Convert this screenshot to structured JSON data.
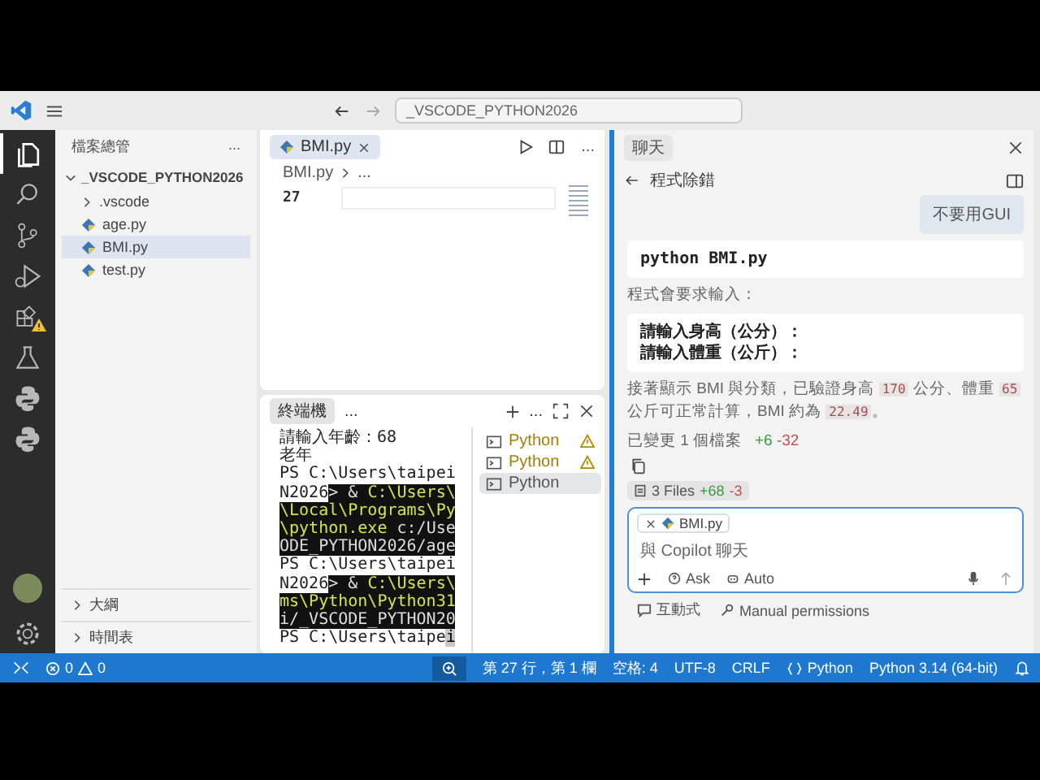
{
  "title_bar": {
    "search": "_VSCODE_PYTHON2026"
  },
  "activity_bar": {
    "items": [
      {
        "kind": "files",
        "selected": true,
        "warning": false
      },
      {
        "kind": "search",
        "selected": false,
        "warning": false
      },
      {
        "kind": "scm",
        "selected": false,
        "warning": false
      },
      {
        "kind": "debug",
        "selected": false,
        "warning": false
      },
      {
        "kind": "extensions",
        "selected": false,
        "warning": true
      },
      {
        "kind": "testing",
        "selected": false,
        "warning": false
      },
      {
        "kind": "python",
        "selected": false,
        "warning": false
      },
      {
        "kind": "python",
        "selected": false,
        "warning": false
      }
    ]
  },
  "sidebar": {
    "title": "檔案總管",
    "more": "...",
    "tree": {
      "label": "_VSCODE_PYTHON2026",
      "expanded": true,
      "children": [
        {
          "label": ".vscode",
          "kind": "folder",
          "expanded": false,
          "selected": false
        },
        {
          "label": "age.py",
          "kind": "file",
          "selected": false
        },
        {
          "label": "BMI.py",
          "kind": "file",
          "selected": true
        },
        {
          "label": "test.py",
          "kind": "file",
          "selected": false
        }
      ]
    },
    "sections": [
      {
        "label": "大綱",
        "expanded": false
      },
      {
        "label": "時間表",
        "expanded": false
      }
    ]
  },
  "editor": {
    "tabs": [
      {
        "label": "BMI.py",
        "selected": true
      }
    ],
    "more": "...",
    "breadcrumb": [
      "BMI.py",
      "..."
    ],
    "line_number": "27"
  },
  "terminal": {
    "tab": "終端機",
    "more": "...",
    "more_right": "...",
    "lines": [
      [
        {
          "text": "請輸入年齡：68",
          "kind": "plain"
        }
      ],
      [
        {
          "text": "老年",
          "kind": "plain"
        }
      ],
      [
        {
          "text": "PS C:\\Users\\taipei",
          "kind": "plain"
        }
      ],
      [
        {
          "text": "N2026",
          "kind": "plain"
        },
        {
          "text": "> & ",
          "kind": "selected"
        },
        {
          "text": "C:\\Users\\",
          "kind": "selected-path"
        }
      ],
      [
        {
          "text": "\\Local\\Programs\\Py",
          "kind": "selected-path"
        }
      ],
      [
        {
          "text": "\\python.exe",
          "kind": "selected-path"
        },
        {
          "text": " c:/Use",
          "kind": "selected"
        }
      ],
      [
        {
          "text": "ODE_PYTHON2026/age",
          "kind": "selected"
        }
      ],
      [
        {
          "text": "PS C:\\Users\\taipei",
          "kind": "plain"
        }
      ],
      [
        {
          "text": "N2026",
          "kind": "plain"
        },
        {
          "text": "> & ",
          "kind": "selected"
        },
        {
          "text": "C:\\Users\\",
          "kind": "selected-path"
        }
      ],
      [
        {
          "text": "ms\\Python\\Python31",
          "kind": "selected-path"
        }
      ],
      [
        {
          "text": "i/_VSCODE_PYTHON20",
          "kind": "selected"
        }
      ],
      [
        {
          "text": "PS C:\\Users\\taipe",
          "kind": "plain"
        },
        {
          "text": "i",
          "kind": "cursor"
        }
      ]
    ],
    "sessions": [
      {
        "label": "Python",
        "warning": true,
        "selected": false
      },
      {
        "label": "Python",
        "warning": true,
        "selected": false
      },
      {
        "label": "Python",
        "warning": false,
        "selected": true
      }
    ]
  },
  "chat": {
    "tab": "聊天",
    "heading": "程式除錯",
    "user_message": "不要用GUI",
    "code_1": [
      "python BMI.py"
    ],
    "text_1": "程式會要求輸入：",
    "code_2": [
      "請輸入身高（公分）：",
      "請輸入體重（公斤）："
    ],
    "paragraph": [
      {
        "text": "接著顯示 BMI 與分類，已驗證身高 ",
        "kind": "text"
      },
      {
        "text": "170",
        "kind": "code"
      },
      {
        "text": " 公分、體重 ",
        "kind": "text"
      },
      {
        "text": "65",
        "kind": "code"
      },
      {
        "text": " 公斤可正常計算，BMI 約為 ",
        "kind": "text"
      },
      {
        "text": "22.49",
        "kind": "code"
      },
      {
        "text": "。",
        "kind": "text"
      }
    ],
    "changed": {
      "label": "已變更 1 個檔案",
      "added": "+6",
      "removed": "-32"
    },
    "files_chip": {
      "label": "3 Files",
      "added": "+68",
      "removed": "-3"
    },
    "input": {
      "attachment": "BMI.py",
      "placeholder": "與 Copilot 聊天",
      "mode": "Ask",
      "model": "Auto"
    },
    "footer": [
      "互動式",
      "Manual permissions"
    ]
  },
  "status_bar": {
    "errors": "0",
    "warnings": "0",
    "position": "第 27 行，第 1 欄",
    "indent": "空格: 4",
    "encoding": "UTF-8",
    "eol": "CRLF",
    "language": "Python",
    "interpreter": "Python 3.14 (64-bit)"
  }
}
